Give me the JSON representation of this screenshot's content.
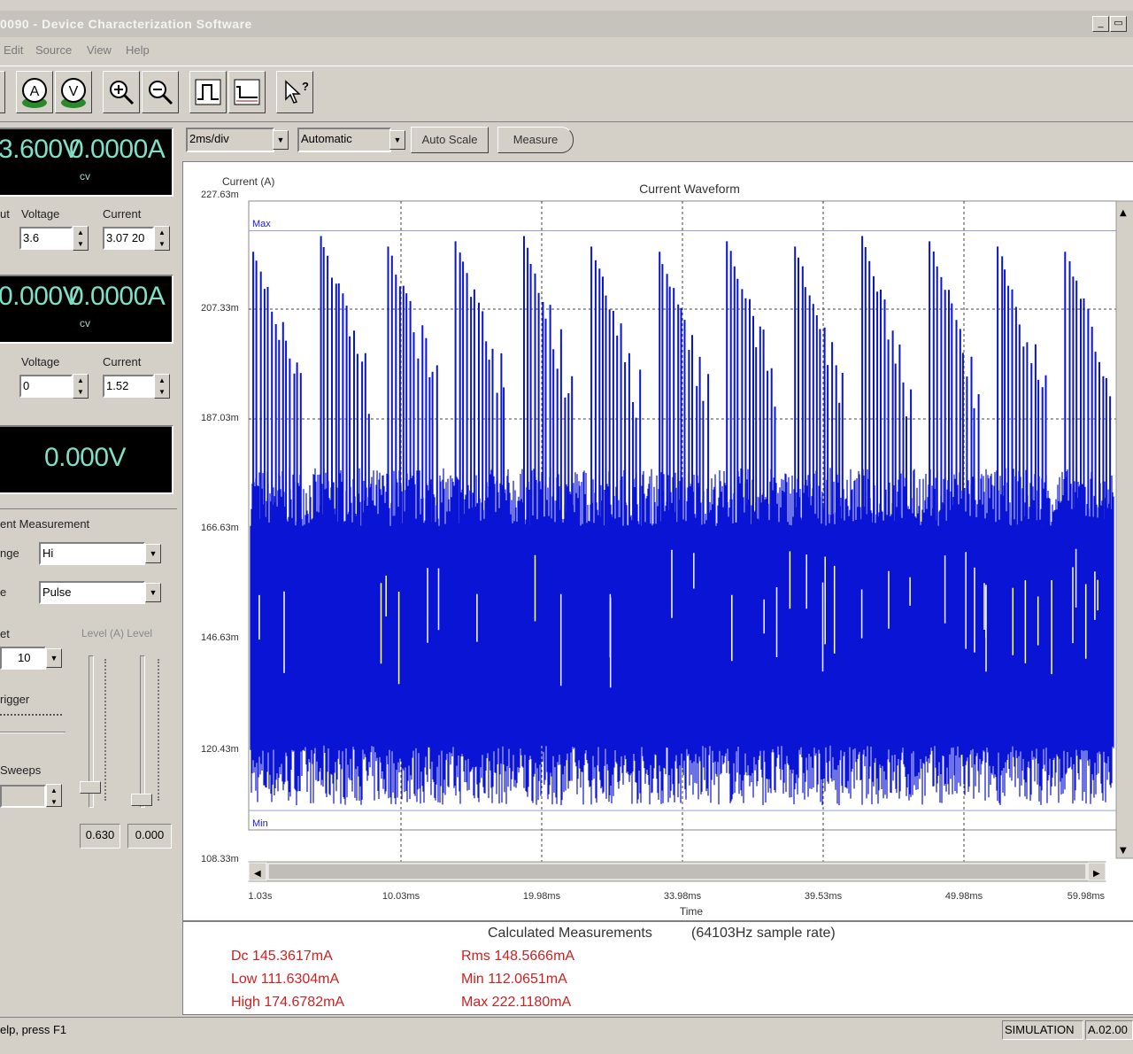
{
  "window": {
    "title": "0090 - Device Characterization Software",
    "controls": [
      "_",
      "ə"
    ]
  },
  "menu": {
    "items": [
      "Edit",
      "Source",
      "View",
      "Help"
    ]
  },
  "toolbar": {
    "buttons": [
      "ammeter-icon",
      "voltmeter-icon",
      "zoom-in-icon",
      "zoom-out-icon",
      "pulse-icon",
      "waveform-icon",
      "help-icon"
    ]
  },
  "plot_toolbar": {
    "timebase": "2ms/div",
    "trigger_mode": "Automatic",
    "auto_scale_label": "Auto Scale",
    "measure_label": "Measure"
  },
  "left_panel": {
    "output1": {
      "voltage_display": "3.600V",
      "current_display": "0.0000A",
      "mode": "cv",
      "row_label": "ut",
      "voltage_label": "Voltage",
      "current_label": "Current",
      "voltage_value": "3.6",
      "current_value": "3.07 20"
    },
    "output2": {
      "voltage_display": "0.000V",
      "current_display": "0.0000A",
      "mode": "cv",
      "voltage_label": "Voltage",
      "current_label": "Current",
      "voltage_value": "0",
      "current_value": "1.52"
    },
    "dvm": {
      "display": "0.000V"
    },
    "measurement": {
      "title": "ent Measurement",
      "range_label": "nge",
      "range_value": "Hi",
      "type_label": "e",
      "type_value": "Pulse",
      "set_label": "et",
      "set_value": "10",
      "level_label": "Level (A) Level",
      "trigger_label": "rigger",
      "sweeps_label": "Sweeps",
      "level_readout_1": "0.630",
      "level_readout_2": "0.000"
    }
  },
  "chart": {
    "y_axis_title": "Current (A)",
    "chart_title": "Current Waveform",
    "x_axis_title": "Time",
    "max_label": "Max",
    "min_label": "Min",
    "y_tick_labels": [
      "227.63m",
      "207.33m",
      "187.03m",
      "166.63m",
      "146.63m",
      "120.43m",
      "108.33m"
    ],
    "x_tick_labels": [
      "1.03s",
      "10.03ms",
      "19.98ms",
      "33.98ms",
      "39.53ms",
      "49.98ms",
      "59.98ms"
    ],
    "colors": {
      "series": "#0a14d4",
      "grid": "#444444"
    }
  },
  "chart_data": {
    "type": "line",
    "title": "Current Waveform",
    "xlabel": "Time",
    "ylabel": "Current (A)",
    "ylim": [
      108.33,
      227.63
    ],
    "x_range_ms": [
      0,
      60
    ],
    "series": [
      {
        "values_low_band": [
          113,
          132
        ],
        "values_high_band_mA": [
          166,
          177
        ],
        "burst_spike_peaks_mA": [
          218,
          221,
          219,
          220,
          221,
          219,
          218,
          220,
          219,
          221,
          220,
          219,
          218
        ]
      }
    ],
    "grid": "dashed",
    "legend": "none"
  },
  "calculated": {
    "title": "Calculated Measurements",
    "rate": "(64103Hz sample rate)",
    "dc": "Dc 145.3617mA",
    "low": "Low 111.6304mA",
    "high": "High 174.6782mA",
    "rms": "Rms 148.5666mA",
    "min": "Min 112.0651mA",
    "max": "Max 222.1180mA"
  },
  "status": {
    "help": "elp, press F1",
    "mode": "SIMULATION",
    "version": "A.02.00"
  }
}
